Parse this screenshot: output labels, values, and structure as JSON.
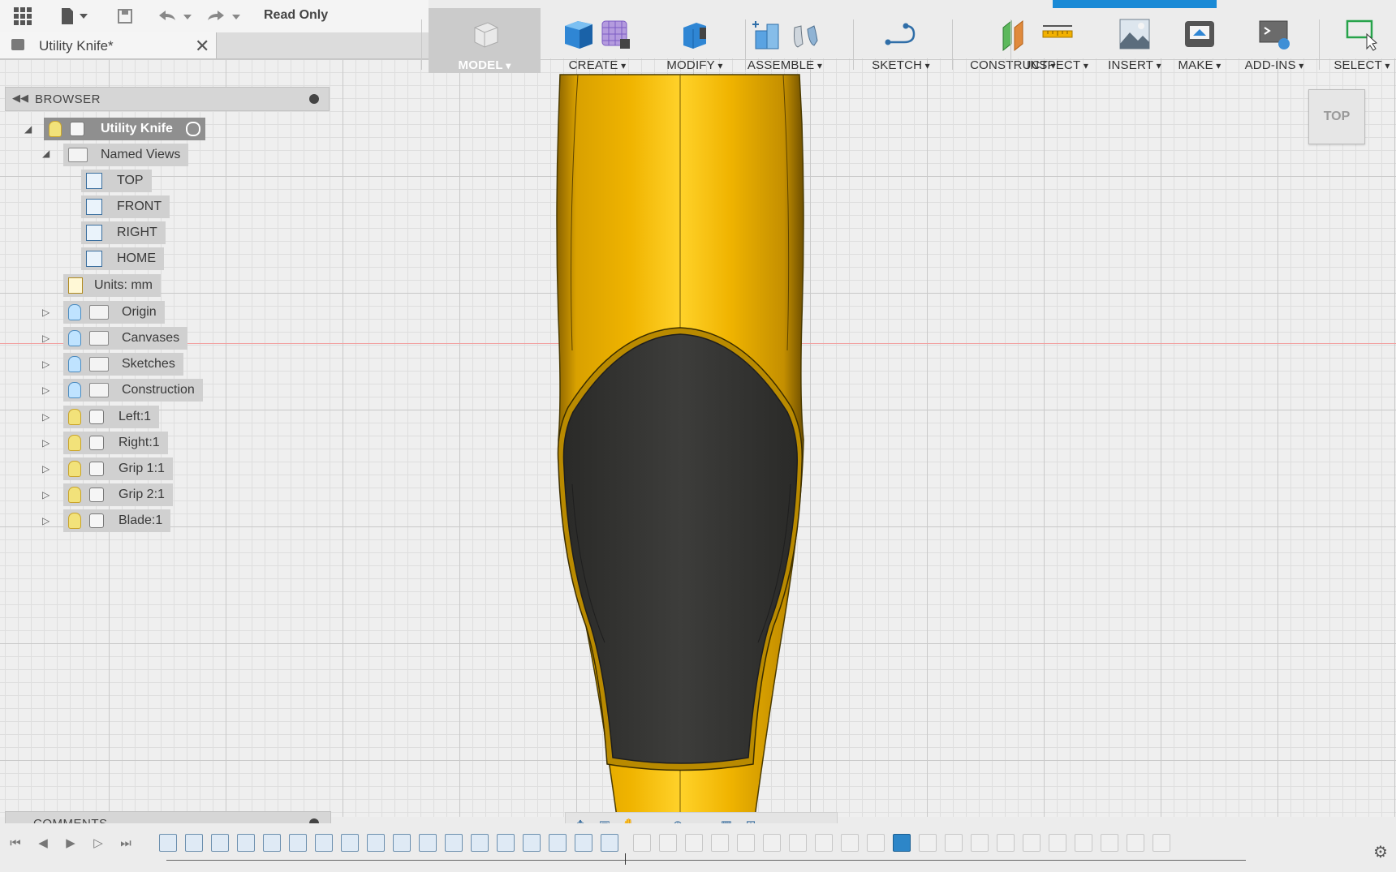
{
  "app": {
    "read_only_label": "Read Only",
    "accent_color": "#1a8ad6"
  },
  "document_tab": {
    "title": "Utility Knife*",
    "close_glyph": "✕"
  },
  "toolbar": {
    "workspace": "MODEL",
    "items": [
      {
        "label": "CREATE",
        "icon": "box-icon"
      },
      {
        "label": "MODIFY",
        "icon": "push-pull-icon"
      },
      {
        "label": "ASSEMBLE",
        "icon": "assemble-icon"
      },
      {
        "label": "SKETCH",
        "icon": "sketch-curve-icon"
      },
      {
        "label": "CONSTRUCT",
        "icon": "plane-icon"
      },
      {
        "label": "INSPECT",
        "icon": "measure-icon"
      },
      {
        "label": "INSERT",
        "icon": "image-icon"
      },
      {
        "label": "MAKE",
        "icon": "printer-icon"
      },
      {
        "label": "ADD-INS",
        "icon": "script-icon"
      },
      {
        "label": "SELECT",
        "icon": "select-icon"
      }
    ]
  },
  "viewcube": {
    "face": "TOP"
  },
  "browser": {
    "title": "BROWSER",
    "root": "Utility Knife",
    "named_views_label": "Named Views",
    "named_views": [
      "TOP",
      "FRONT",
      "RIGHT",
      "HOME"
    ],
    "units": "Units: mm",
    "folders": [
      "Origin",
      "Canvases",
      "Sketches",
      "Construction"
    ],
    "bodies": [
      "Left:1",
      "Right:1",
      "Grip 1:1",
      "Grip 2:1",
      "Blade:1"
    ]
  },
  "comments": {
    "title": "COMMENTS"
  },
  "model": {
    "body_color": "#f1b800",
    "grip_color": "#3a3a38"
  }
}
